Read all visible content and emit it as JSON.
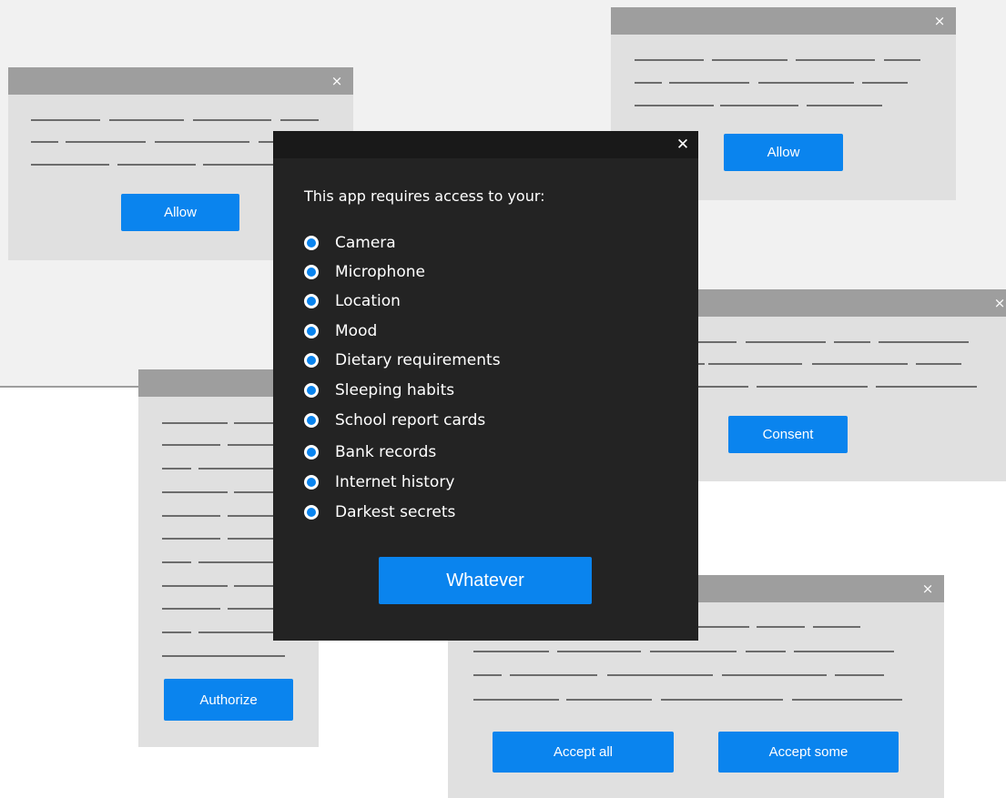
{
  "windows": {
    "top_left": {
      "close": "×",
      "button": "Allow"
    },
    "top_right": {
      "close": "×",
      "button": "Allow"
    },
    "middle_right": {
      "close": "×",
      "button": "Consent"
    },
    "left_tall": {
      "button": "Authorize"
    },
    "bottom_right": {
      "close": "×",
      "button_primary": "Accept all",
      "button_secondary": "Accept some"
    }
  },
  "dialog": {
    "close": "✕",
    "prompt": "This app requires access to your:",
    "permissions": [
      "Camera",
      "Microphone",
      "Location",
      "Mood",
      "Dietary requirements",
      "Sleeping habits",
      "School report cards",
      "Bank records",
      "Internet history",
      "Darkest secrets"
    ],
    "action": "Whatever"
  },
  "colors": {
    "accent": "#0a84ee",
    "dialog_bg": "#232323",
    "window_bg": "#e0e0e0",
    "titlebar": "#9e9e9e"
  }
}
